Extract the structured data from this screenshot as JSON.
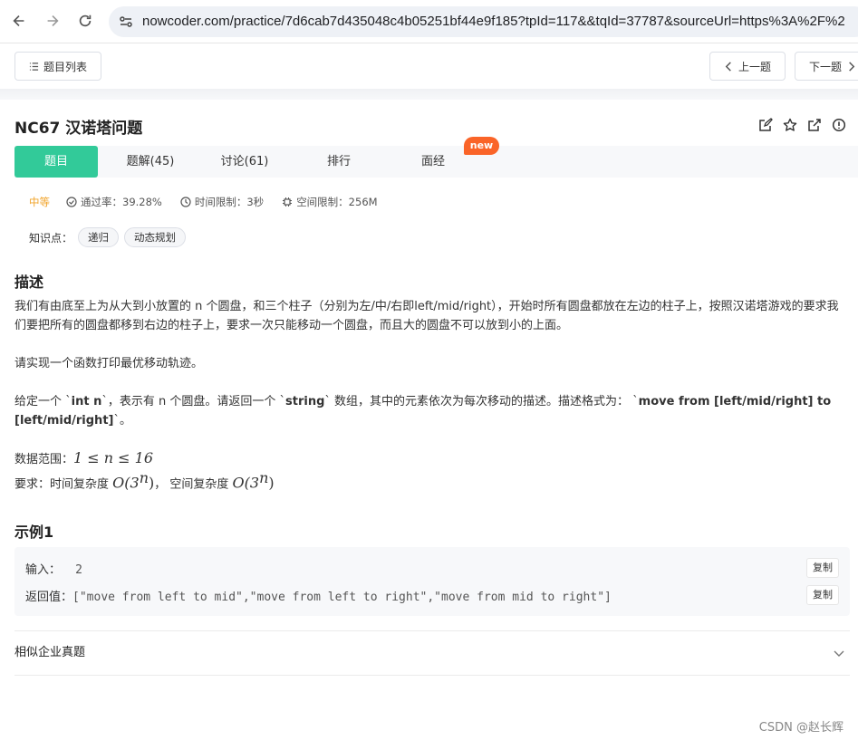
{
  "browser": {
    "url_text": "nowcoder.com/practice/7d6cab7d435048c4b05251bf44e9f185?tpId=117&&tqId=37787&sourceUrl=https%3A%2F%2"
  },
  "toolbar": {
    "list_label": "题目列表",
    "prev_label": "上一题",
    "next_label": "下一题"
  },
  "problem": {
    "title": "NC67  汉诺塔问题"
  },
  "tabs": [
    {
      "label": "题目"
    },
    {
      "label": "题解(45)"
    },
    {
      "label": "讨论(61)"
    },
    {
      "label": "排行"
    },
    {
      "label": "面经"
    }
  ],
  "new_badge": "new",
  "meta": {
    "difficulty": "中等",
    "pass_rate": "通过率：39.28%",
    "time_limit": "时间限制：3秒",
    "space_limit": "空间限制：256M"
  },
  "knowledge": {
    "label": "知识点：",
    "tags": [
      "递归",
      "动态规划"
    ]
  },
  "description": {
    "heading": "描述",
    "p1": "我们有由底至上为从大到小放置的 n 个圆盘，和三个柱子（分别为左/中/右即left/mid/right），开始时所有圆盘都放在左边的柱子上，按照汉诺塔游戏的要求我们要把所有的圆盘都移到右边的柱子上，要求一次只能移动一个圆盘，而且大的圆盘不可以放到小的上面。",
    "p2": "请实现一个函数打印最优移动轨迹。",
    "p3_a": "给定一个 `",
    "p3_b": "int n",
    "p3_c": "`，表示有 n 个圆盘。请返回一个 `",
    "p3_d": "string",
    "p3_e": "` 数组，其中的元素依次为每次移动的描述。描述格式为： `",
    "p3_f": "move from [left/mid/right] to [left/mid/right]",
    "p3_g": "`。",
    "range_label": "数据范围：",
    "range_expr": "1 ≤ n ≤ 16",
    "req_label": "要求：时间复杂度 ",
    "req_time": "O(3",
    "req_exp": "n",
    "req_close": ")",
    "req_sep": "， 空间复杂度 ",
    "req_space": "O(3",
    "req_exp2": "n",
    "req_close2": ")"
  },
  "example": {
    "heading": "示例1",
    "input_label": "输入：",
    "input_value": "2",
    "output_label": "返回值：",
    "output_value": "[\"move from left to mid\",\"move from left to right\",\"move from mid to right\"]",
    "copy_label": "复制"
  },
  "similar": {
    "label": "相似企业真题"
  },
  "watermark": "CSDN @赵长辉",
  "colors": {
    "accent": "#32ca99",
    "badge": "#fa6428",
    "difficulty": "#f1a42b"
  }
}
